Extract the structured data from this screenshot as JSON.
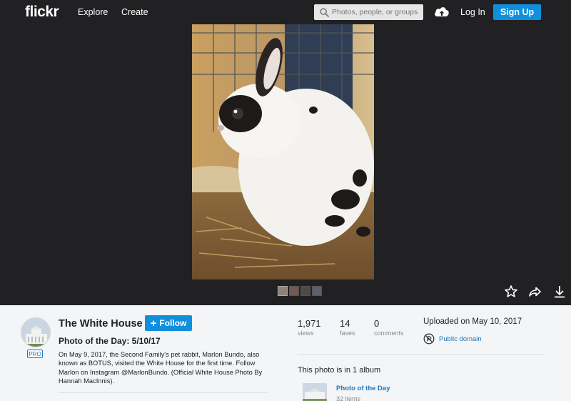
{
  "nav": {
    "logo": "flickr",
    "explore": "Explore",
    "create": "Create",
    "search_placeholder": "Photos, people, or groups",
    "login": "Log In",
    "signup": "Sign Up"
  },
  "icons": {
    "search": "search-icon",
    "upload": "cloud-upload-icon",
    "fave": "star-icon",
    "share": "share-icon",
    "download": "download-icon",
    "license": "public-domain-icon"
  },
  "owner": {
    "name": "The White House",
    "badge": "PRO",
    "follow_label": "Follow"
  },
  "photo": {
    "title": "Photo of the Day: 5/10/17",
    "description": "On May 9, 2017, the Second Family's pet rabbit, Marlon Bundo, also known as BOTUS, visited the White House for the first time. Follow Marlon on Instagram @MarlonBundo. (Official White House Photo By Hannah MacInnis)."
  },
  "stats": {
    "views": {
      "value": "1,971",
      "label": "views"
    },
    "faves": {
      "value": "14",
      "label": "faves"
    },
    "comments": {
      "value": "0",
      "label": "comments"
    }
  },
  "meta": {
    "uploaded": "Uploaded on May 10, 2017",
    "license": "Public domain"
  },
  "albums": {
    "heading": "This photo is in 1 album",
    "items": [
      {
        "name": "Photo of the Day",
        "count": "32 items"
      }
    ]
  },
  "colors": {
    "accent": "#128fdc",
    "link": "#1b77c0",
    "header_bg": "#212124",
    "page_bg": "#f3f5f6"
  }
}
